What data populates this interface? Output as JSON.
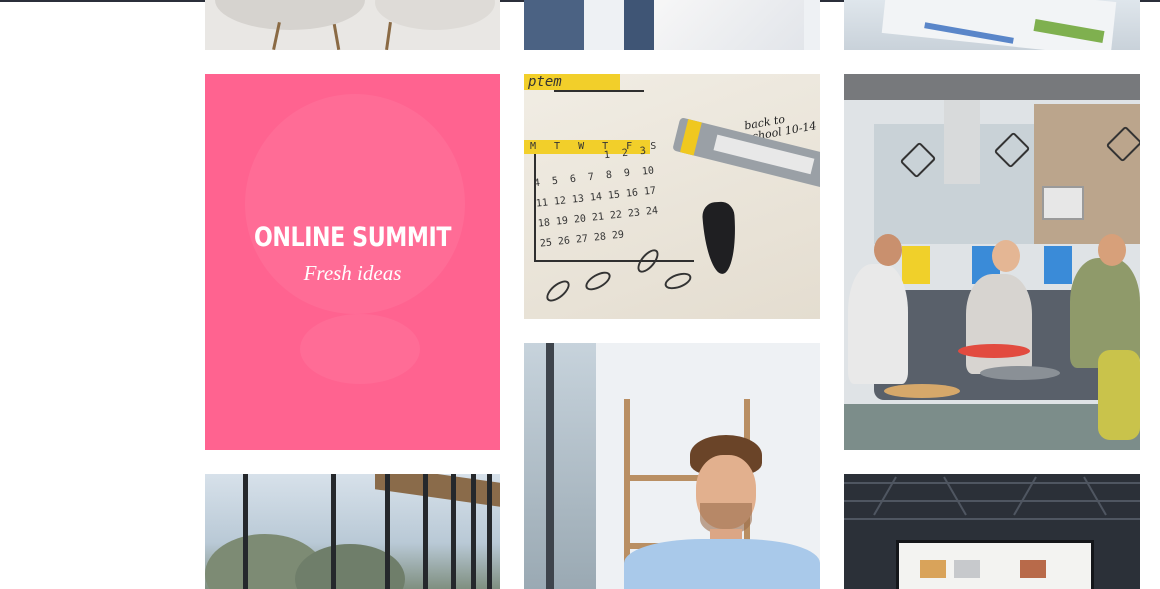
{
  "card": {
    "title": "ONLINE SUMMIT",
    "subtitle": "Fresh ideas",
    "background": "#ff6390"
  },
  "gallery": {
    "tiles": [
      {
        "name": "chairs-photo"
      },
      {
        "name": "team-photo"
      },
      {
        "name": "desk-photo"
      },
      {
        "name": "online-summit-card"
      },
      {
        "name": "calendar-notebook-photo"
      },
      {
        "name": "office-lounge-photo"
      },
      {
        "name": "smiling-man-photo"
      },
      {
        "name": "glass-windows-photo"
      },
      {
        "name": "presentation-hall-photo"
      }
    ]
  },
  "calendar_photo": {
    "month_fragment": "ptem",
    "weekdays": "M T W T F S S",
    "note": "back to school 10-14 ue",
    "pen_brand": "WINSOR & NEWTON",
    "pen_label": "WATER COLOUR MARKER",
    "days": [
      "1",
      "2",
      "3",
      "4",
      "5",
      "6",
      "7",
      "8",
      "9",
      "10",
      "11",
      "12",
      "13",
      "14",
      "15",
      "16",
      "17",
      "18",
      "19",
      "20",
      "21",
      "22",
      "23",
      "24",
      "25",
      "26",
      "27",
      "28",
      "29"
    ]
  },
  "colors": {
    "accent_pink": "#ff6390",
    "top_bar": "#2b2f3a"
  }
}
